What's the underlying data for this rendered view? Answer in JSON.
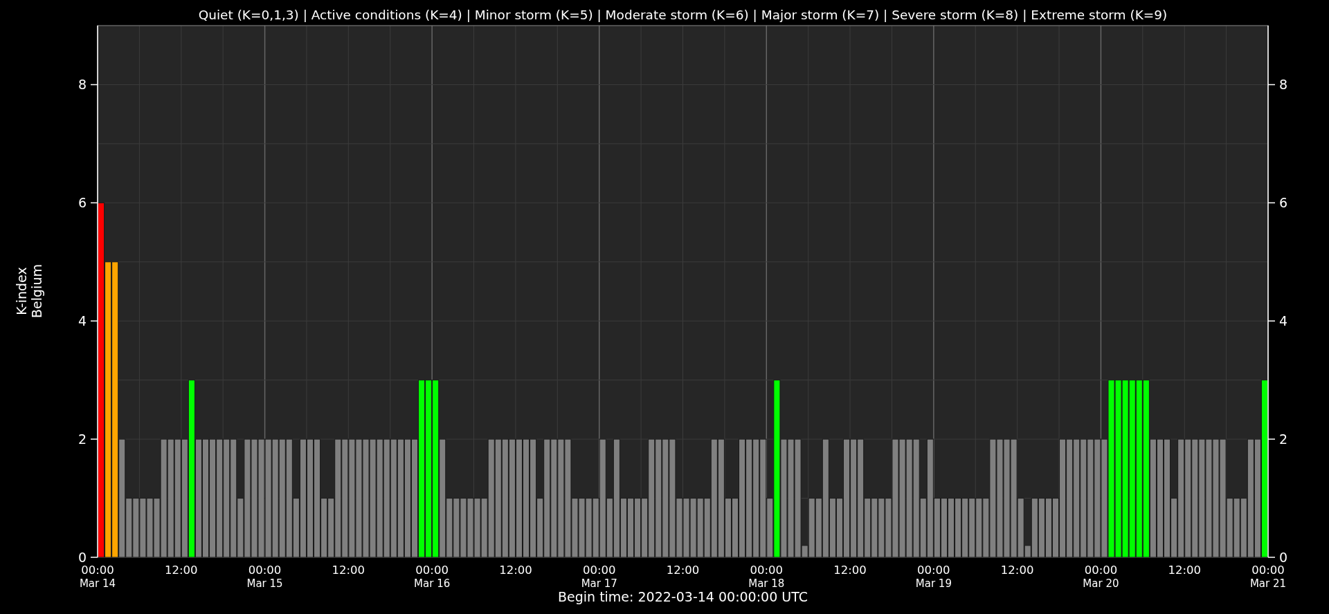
{
  "chart_data": {
    "type": "bar",
    "title": "Quiet (K=0,1,3) | Active conditions (K=4) | Minor storm (K=5) | Moderate storm (K=6) | Major storm (K=7) | Severe storm (K=8) | Extreme storm (K=9)",
    "xlabel": "Begin time: 2022-03-14 00:00:00 UTC",
    "ylabel": "K-index\nBelgium",
    "ylim": [
      0,
      9
    ],
    "grid": true,
    "yticks": [
      0,
      2,
      4,
      6,
      8
    ],
    "categories": [
      "00:00\nMar 14",
      null,
      null,
      null,
      null,
      null,
      null,
      null,
      null,
      null,
      null,
      null,
      "12:00",
      null,
      null,
      null,
      null,
      null,
      null,
      null,
      null,
      null,
      null,
      null,
      "00:00\nMar 15",
      null,
      null,
      null,
      null,
      null,
      null,
      null,
      null,
      null,
      null,
      null,
      "12:00",
      null,
      null,
      null,
      null,
      null,
      null,
      null,
      null,
      null,
      null,
      null,
      "00:00\nMar 16",
      null,
      null,
      null,
      null,
      null,
      null,
      null,
      null,
      null,
      null,
      null,
      "12:00",
      null,
      null,
      null,
      null,
      null,
      null,
      null,
      null,
      null,
      null,
      null,
      "00:00\nMar 17",
      null,
      null,
      null,
      null,
      null,
      null,
      null,
      null,
      null,
      null,
      null,
      "12:00",
      null,
      null,
      null,
      null,
      null,
      null,
      null,
      null,
      null,
      null,
      null,
      "00:00\nMar 18",
      null,
      null,
      null,
      null,
      null,
      null,
      null,
      null,
      null,
      null,
      null,
      "12:00",
      null,
      null,
      null,
      null,
      null,
      null,
      null,
      null,
      null,
      null,
      null,
      "00:00\nMar 19",
      null,
      null,
      null,
      null,
      null,
      null,
      null,
      null,
      null,
      null,
      null,
      "12:00",
      null,
      null,
      null,
      null,
      null,
      null,
      null,
      null,
      null,
      null,
      null,
      "00:00\nMar 20",
      null,
      null,
      null,
      null,
      null,
      null,
      null,
      null,
      null,
      null,
      null,
      "12:00",
      null,
      null,
      null,
      null,
      null,
      null,
      null,
      null,
      null,
      null,
      null,
      "00:00\nMar 21"
    ],
    "series": [
      {
        "color": "#808080",
        "values": [
          null,
          null,
          null,
          2,
          1,
          1,
          1,
          1,
          1,
          2,
          2,
          2,
          2,
          null,
          2,
          2,
          2,
          2,
          2,
          2,
          1,
          2,
          2,
          2,
          2,
          2,
          2,
          2,
          1,
          2,
          2,
          2,
          1,
          1,
          2,
          2,
          2,
          2,
          2,
          2,
          2,
          2,
          2,
          2,
          2,
          2,
          null,
          null,
          null,
          2,
          1,
          1,
          1,
          1,
          1,
          1,
          2,
          2,
          2,
          2,
          2,
          2,
          2,
          1,
          2,
          2,
          2,
          2,
          1,
          1,
          1,
          1,
          2,
          1,
          2,
          1,
          1,
          1,
          1,
          2,
          2,
          2,
          2,
          1,
          1,
          1,
          1,
          1,
          2,
          2,
          1,
          1,
          2,
          2,
          2,
          2,
          1,
          null,
          2,
          2,
          2,
          0.2,
          1,
          1,
          2,
          1,
          1,
          2,
          2,
          2,
          1,
          1,
          1,
          1,
          2,
          2,
          2,
          2,
          1,
          2,
          1,
          1,
          1,
          1,
          1,
          1,
          1,
          1,
          2,
          2,
          2,
          2,
          1,
          0.2,
          1,
          1,
          1,
          1,
          2,
          2,
          2,
          2,
          2,
          2,
          2,
          null,
          null,
          null,
          null,
          null,
          null,
          2,
          2,
          2,
          1,
          2,
          2,
          2,
          2,
          2,
          2,
          2,
          1,
          1,
          1,
          2,
          2,
          null,
          null
        ]
      },
      {
        "color": "#00ff00",
        "values": [
          null,
          null,
          null,
          null,
          null,
          null,
          null,
          null,
          null,
          null,
          null,
          null,
          null,
          3,
          null,
          null,
          null,
          null,
          null,
          null,
          null,
          null,
          null,
          null,
          null,
          null,
          null,
          null,
          null,
          null,
          null,
          null,
          null,
          null,
          null,
          null,
          null,
          null,
          null,
          null,
          null,
          null,
          null,
          null,
          null,
          null,
          3,
          3,
          3,
          null,
          null,
          null,
          null,
          null,
          null,
          null,
          null,
          null,
          null,
          null,
          null,
          null,
          null,
          null,
          null,
          null,
          null,
          null,
          null,
          null,
          null,
          null,
          null,
          null,
          null,
          null,
          null,
          null,
          null,
          null,
          null,
          null,
          null,
          null,
          null,
          null,
          null,
          null,
          null,
          null,
          null,
          null,
          null,
          null,
          null,
          null,
          null,
          3,
          null,
          null,
          null,
          null,
          null,
          null,
          null,
          null,
          null,
          null,
          null,
          null,
          null,
          null,
          null,
          null,
          null,
          null,
          null,
          null,
          null,
          null,
          null,
          null,
          null,
          null,
          null,
          null,
          null,
          null,
          null,
          null,
          null,
          null,
          null,
          null,
          null,
          null,
          null,
          null,
          null,
          null,
          null,
          null,
          null,
          null,
          null,
          3,
          3,
          3,
          3,
          3,
          3,
          null,
          null,
          null,
          null,
          null,
          null,
          null,
          null,
          null,
          null,
          null,
          null,
          null,
          null,
          null,
          null,
          3,
          null
        ]
      },
      {
        "color": "#ffa500",
        "values": [
          null,
          5,
          5,
          null,
          null,
          null,
          null,
          null,
          null,
          null,
          null,
          null,
          null,
          null,
          null,
          null,
          null,
          null,
          null,
          null,
          null,
          null,
          null,
          null,
          null,
          null,
          null,
          null,
          null,
          null,
          null,
          null,
          null,
          null,
          null,
          null,
          null,
          null,
          null,
          null,
          null,
          null,
          null,
          null,
          null,
          null,
          null,
          null,
          null,
          null,
          null,
          null,
          null,
          null,
          null,
          null,
          null,
          null,
          null,
          null,
          null,
          null,
          null,
          null,
          null,
          null,
          null,
          null,
          null,
          null,
          null,
          null,
          null,
          null,
          null,
          null,
          null,
          null,
          null,
          null,
          null,
          null,
          null,
          null,
          null,
          null,
          null,
          null,
          null,
          null,
          null,
          null,
          null,
          null,
          null,
          null,
          null,
          null,
          null,
          null,
          null,
          null,
          null,
          null,
          null,
          null,
          null,
          null,
          null,
          null,
          null,
          null,
          null,
          null,
          null,
          null,
          null,
          null,
          null,
          null,
          null,
          null,
          null,
          null,
          null,
          null,
          null,
          null,
          null,
          null,
          null,
          null,
          null,
          null,
          null,
          null,
          null,
          null,
          null,
          null,
          null,
          null,
          null,
          null,
          null,
          null,
          null,
          null,
          null,
          null,
          null,
          null,
          null,
          null,
          null,
          null,
          null,
          null,
          null,
          null,
          null,
          null,
          null,
          null,
          null,
          null,
          null,
          null,
          null
        ]
      },
      {
        "color": "#ff0000",
        "values": [
          6,
          null,
          null,
          null,
          null,
          null,
          null,
          null,
          null,
          null,
          null,
          null,
          null,
          null,
          null,
          null,
          null,
          null,
          null,
          null,
          null,
          null,
          null,
          null,
          null,
          null,
          null,
          null,
          null,
          null,
          null,
          null,
          null,
          null,
          null,
          null,
          null,
          null,
          null,
          null,
          null,
          null,
          null,
          null,
          null,
          null,
          null,
          null,
          null,
          null,
          null,
          null,
          null,
          null,
          null,
          null,
          null,
          null,
          null,
          null,
          null,
          null,
          null,
          null,
          null,
          null,
          null,
          null,
          null,
          null,
          null,
          null,
          null,
          null,
          null,
          null,
          null,
          null,
          null,
          null,
          null,
          null,
          null,
          null,
          null,
          null,
          null,
          null,
          null,
          null,
          null,
          null,
          null,
          null,
          null,
          null,
          null,
          null,
          null,
          null,
          null,
          null,
          null,
          null,
          null,
          null,
          null,
          null,
          null,
          null,
          null,
          null,
          null,
          null,
          null,
          null,
          null,
          null,
          null,
          null,
          null,
          null,
          null,
          null,
          null,
          null,
          null,
          null,
          null,
          null,
          null,
          null,
          null,
          null,
          null,
          null,
          null,
          null,
          null,
          null,
          null,
          null,
          null,
          null,
          null,
          null,
          null,
          null,
          null,
          null,
          null,
          null,
          null,
          null,
          null,
          null,
          null,
          null,
          null,
          null,
          null,
          null,
          null,
          null,
          null,
          null,
          null,
          null,
          null
        ]
      }
    ]
  },
  "right_axis": {
    "ticks": [
      "8",
      "6",
      "4",
      "2",
      "0"
    ]
  }
}
